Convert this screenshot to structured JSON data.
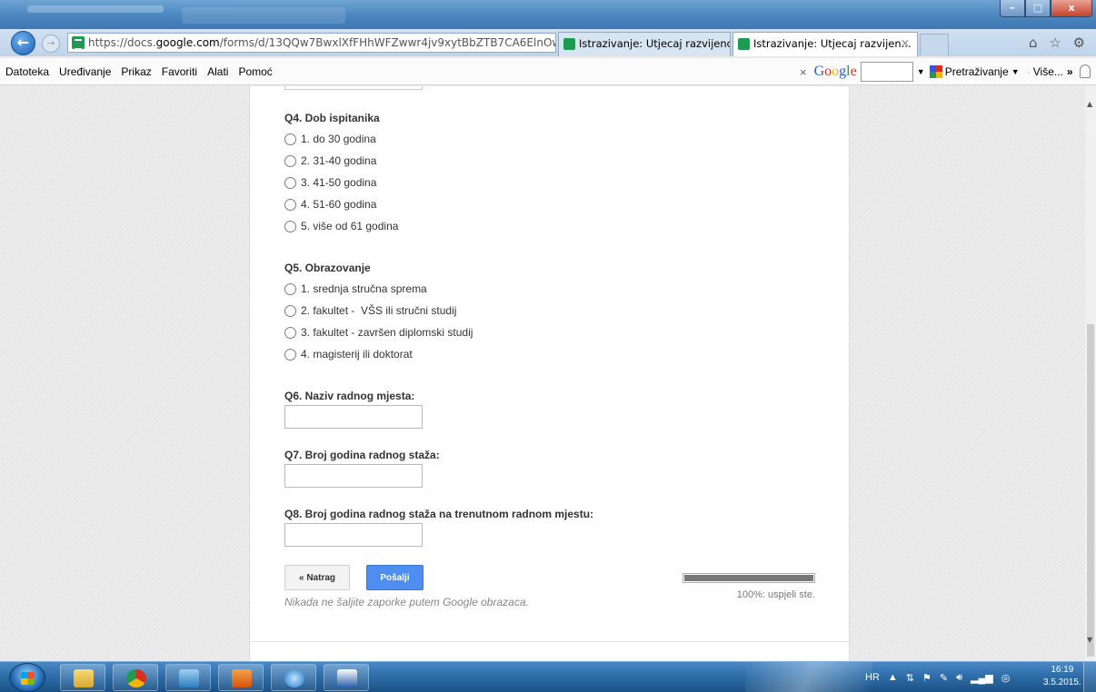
{
  "browser": {
    "url_prefix": "https://docs.",
    "url_domain": "google.com",
    "url_rest": "/forms/d/13QQw7BwxlXfFHhWFZwwr4jv9xytBbZTB7CA6ElnOw",
    "addr_tools": "⌕ ▾ 🔒 ↻",
    "tabs": [
      {
        "label": "Istrazivanje: Utjecaj razvijenosti..."
      },
      {
        "label": "Istrazivanje: Utjecaj razvijen..."
      }
    ],
    "tab_close": "✕",
    "window_buttons": {
      "minimize": "–",
      "maximize": "□",
      "close": "x"
    },
    "right_icons": "⌂ ☆ ⚙"
  },
  "menu": {
    "items": [
      "Datoteka",
      "Uređivanje",
      "Prikaz",
      "Favoriti",
      "Alati",
      "Pomoć"
    ]
  },
  "google_bar": {
    "close": "×",
    "logo": [
      "G",
      "o",
      "o",
      "g",
      "l",
      "e"
    ],
    "search_label": "Pretraživanje",
    "more_label": "Više...",
    "more_arrow": "»"
  },
  "form": {
    "questions": [
      {
        "title": "Q4. Dob ispitanika",
        "options": [
          "1. do 30 godina",
          "2. 31-40 godina",
          "3. 41-50 godina",
          "4. 51-60 godina",
          "5. više od 61 godina"
        ]
      },
      {
        "title": "Q5. Obrazovanje",
        "options": [
          "1. srednja stručna sprema",
          "2. fakultet -  VŠS ili stručni studij",
          "3. fakultet - završen diplomski studij",
          "4. magisterij ili doktorat"
        ]
      },
      {
        "title": "Q6. Naziv radnog mjesta:"
      },
      {
        "title": "Q7. Broj godina radnog staža:"
      },
      {
        "title": "Q8. Broj godina radnog staža na trenutnom radnom mjestu:"
      }
    ],
    "back_label": "« Natrag",
    "submit_label": "Pošalji",
    "note": "Nikada ne šaljite zaporke putem Google obrazaca.",
    "progress_value": 1.0,
    "progress_text": "100%: uspjeli ste."
  },
  "taskbar": {
    "tray_lang": "HR",
    "time": "16:19",
    "date": "3.5.2015."
  }
}
